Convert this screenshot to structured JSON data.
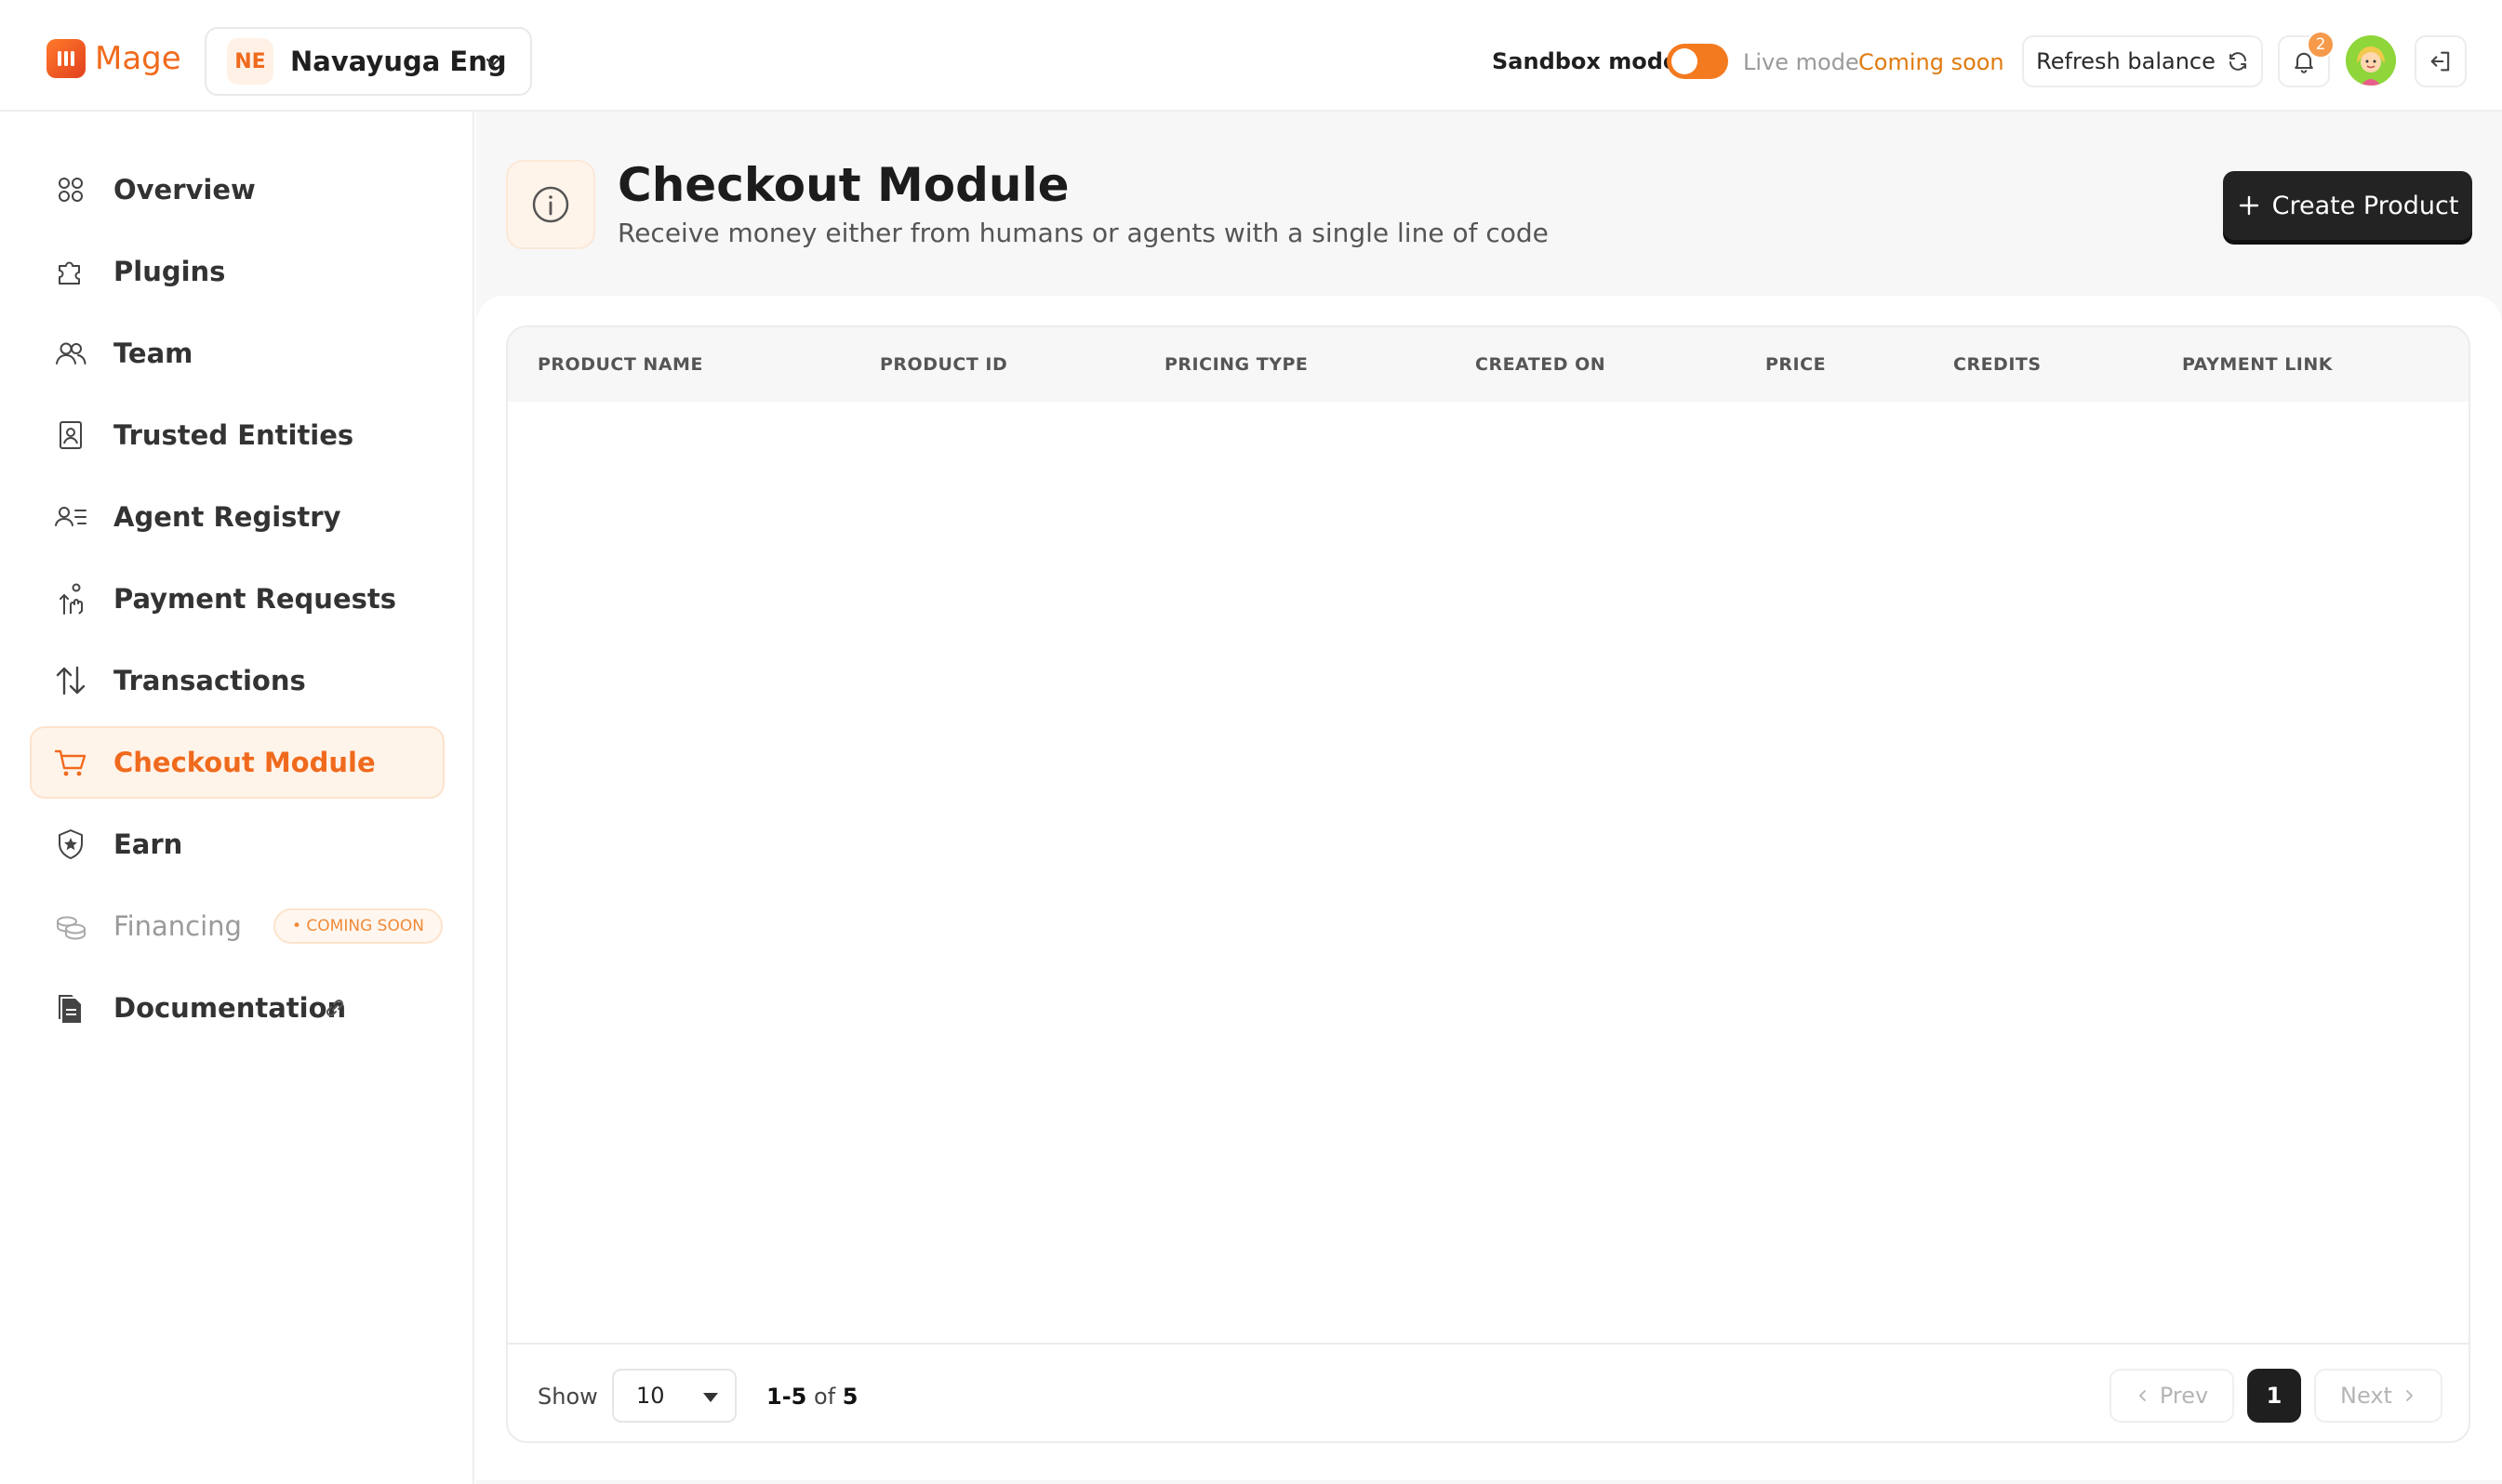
{
  "brand": {
    "name": "Mage"
  },
  "org": {
    "initials": "NE",
    "name": "Navayuga Eng"
  },
  "header": {
    "sandbox_label": "Sandbox mode",
    "sandbox_on": true,
    "live_label": "Live mode",
    "live_status": "Coming soon",
    "refresh_label": "Refresh balance",
    "notification_count": "2"
  },
  "sidebar": {
    "items": [
      {
        "label": "Overview",
        "icon": "grid-icon"
      },
      {
        "label": "Plugins",
        "icon": "puzzle-icon"
      },
      {
        "label": "Team",
        "icon": "users-icon"
      },
      {
        "label": "Trusted Entities",
        "icon": "id-badge-icon"
      },
      {
        "label": "Agent Registry",
        "icon": "user-list-icon"
      },
      {
        "label": "Payment Requests",
        "icon": "hand-pay-icon"
      },
      {
        "label": "Transactions",
        "icon": "arrows-up-down-icon"
      },
      {
        "label": "Checkout Module",
        "icon": "cart-icon",
        "active": true
      },
      {
        "label": "Earn",
        "icon": "shield-star-icon"
      },
      {
        "label": "Financing",
        "icon": "coins-icon",
        "badge": "• COMING SOON"
      },
      {
        "label": "Documentation",
        "icon": "documents-icon"
      }
    ]
  },
  "page": {
    "title": "Checkout Module",
    "subtitle": "Receive money either from humans or agents with a single line of code",
    "create_label": "Create Product"
  },
  "table": {
    "columns": [
      "PRODUCT NAME",
      "PRODUCT ID",
      "PRICING TYPE",
      "CREATED ON",
      "PRICE",
      "CREDITS",
      "PAYMENT LINK"
    ],
    "rows": []
  },
  "pagination": {
    "show_label": "Show",
    "page_size": "10",
    "range_start": "1",
    "range_end": "5",
    "range_of": "of",
    "total": "5",
    "prev_label": "Prev",
    "next_label": "Next",
    "current_page": "1"
  },
  "colors": {
    "accent": "#f06a1d",
    "dark_button": "#232323",
    "toggle": "#f47a1f"
  }
}
